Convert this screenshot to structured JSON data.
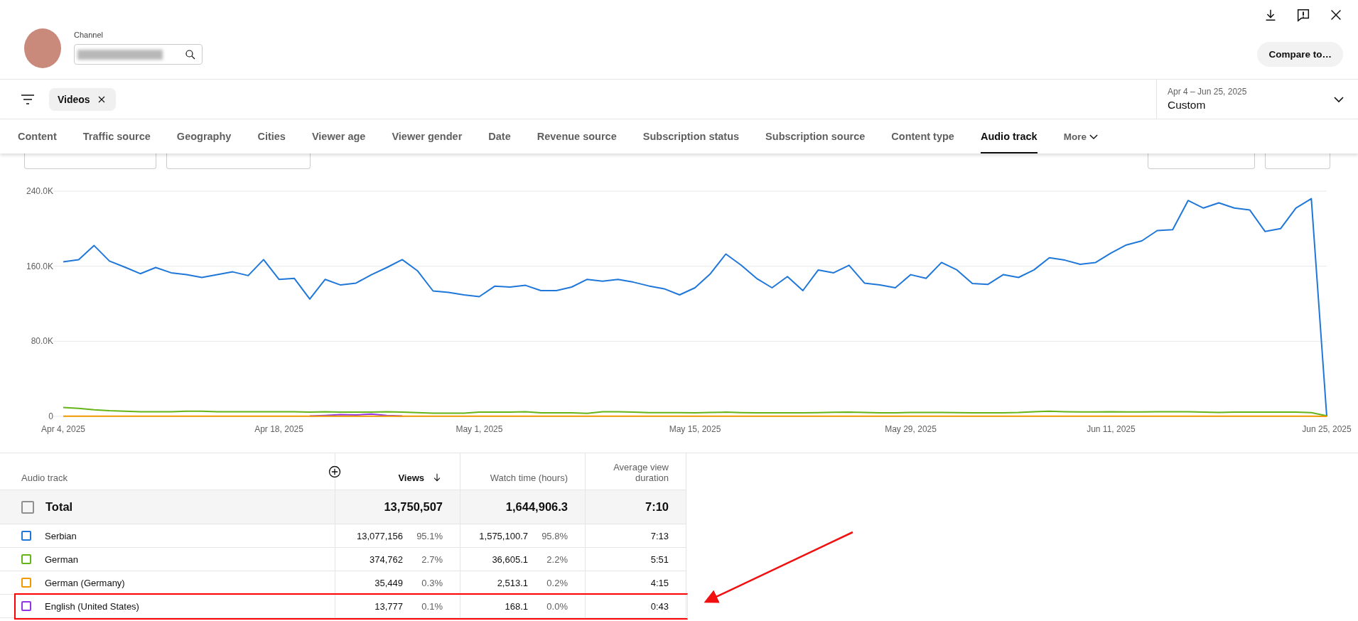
{
  "header": {
    "channel_label": "Channel",
    "compare_button": "Compare to…"
  },
  "filter_bar": {
    "chips": [
      {
        "label": "Videos"
      }
    ],
    "date_range": {
      "range": "Apr 4 – Jun 25, 2025",
      "preset": "Custom"
    }
  },
  "tabs": [
    {
      "label": "Content",
      "selected": false
    },
    {
      "label": "Traffic source",
      "selected": false
    },
    {
      "label": "Geography",
      "selected": false
    },
    {
      "label": "Cities",
      "selected": false
    },
    {
      "label": "Viewer age",
      "selected": false
    },
    {
      "label": "Viewer gender",
      "selected": false
    },
    {
      "label": "Date",
      "selected": false
    },
    {
      "label": "Revenue source",
      "selected": false
    },
    {
      "label": "Subscription status",
      "selected": false
    },
    {
      "label": "Subscription source",
      "selected": false
    },
    {
      "label": "Content type",
      "selected": false
    },
    {
      "label": "Audio track",
      "selected": true
    }
  ],
  "more_tab": {
    "label": "More"
  },
  "chart": {
    "chart_data": {
      "type": "line",
      "categories": [
        "Apr 4, 2025",
        null,
        null,
        null,
        null,
        null,
        null,
        null,
        null,
        null,
        null,
        null,
        null,
        null,
        "Apr 18, 2025",
        null,
        null,
        null,
        null,
        null,
        null,
        null,
        null,
        null,
        null,
        null,
        null,
        "May 1, 2025",
        null,
        null,
        null,
        null,
        null,
        null,
        null,
        null,
        null,
        null,
        null,
        null,
        null,
        "May 15, 2025",
        null,
        null,
        null,
        null,
        null,
        null,
        null,
        null,
        null,
        null,
        null,
        null,
        null,
        "May 29, 2025",
        null,
        null,
        null,
        null,
        null,
        null,
        null,
        null,
        null,
        null,
        null,
        null,
        "Jun 11, 2025",
        null,
        null,
        null,
        null,
        null,
        null,
        null,
        null,
        null,
        null,
        null,
        null,
        null,
        "Jun 25, 2025"
      ],
      "ylim": [
        0,
        240000
      ],
      "yticks": [
        {
          "value": 0,
          "label": "0"
        },
        {
          "value": 80000,
          "label": "80.0K"
        },
        {
          "value": 160000,
          "label": "160.0K"
        },
        {
          "value": 240000,
          "label": "240.0K"
        }
      ],
      "series": [
        {
          "color": "#1f77d9",
          "values": [
            164600,
            167000,
            182000,
            165500,
            159000,
            152000,
            158600,
            153000,
            151000,
            148000,
            151000,
            154000,
            150000,
            167000,
            146000,
            147000,
            125000,
            146000,
            140000,
            142000,
            151000,
            158600,
            167000,
            155000,
            133600,
            132000,
            129500,
            127600,
            138700,
            137800,
            139600,
            134000,
            134000,
            137800,
            146000,
            144000,
            146000,
            143000,
            139000,
            136000,
            129500,
            137000,
            152000,
            173000,
            161000,
            147000,
            137000,
            149000,
            134000,
            156000,
            153000,
            161000,
            142000,
            140000,
            137000,
            151000,
            147000,
            164000,
            156000,
            141500,
            140600,
            151000,
            148000,
            156000,
            169000,
            166500,
            162000,
            164000,
            174000,
            182700,
            187000,
            198000,
            199000,
            230000,
            222000,
            227500,
            222000,
            220000,
            197000,
            200000,
            222000,
            232000,
            0
          ]
        },
        {
          "color": "#65b418",
          "values": [
            9500,
            8500,
            7000,
            6000,
            5500,
            5000,
            5000,
            5000,
            5500,
            5500,
            5000,
            5000,
            5000,
            5000,
            5000,
            5000,
            4500,
            5000,
            4500,
            4500,
            4500,
            5000,
            4500,
            4000,
            3500,
            3500,
            3500,
            4500,
            4500,
            4500,
            5000,
            3800,
            3800,
            3800,
            3200,
            5000,
            5000,
            4500,
            4000,
            4000,
            4000,
            3800,
            4200,
            4500,
            4000,
            3800,
            3800,
            3800,
            3800,
            4000,
            4300,
            4500,
            4200,
            3800,
            3800,
            4200,
            4200,
            4200,
            4000,
            3800,
            3800,
            3800,
            4200,
            5000,
            5500,
            5000,
            4800,
            4800,
            5000,
            4800,
            4800,
            5000,
            5000,
            5000,
            4500,
            4200,
            4500,
            4500,
            4500,
            4500,
            4500,
            4000,
            500
          ]
        },
        {
          "color": "#9334e6",
          "values": [
            null,
            null,
            null,
            null,
            null,
            null,
            null,
            null,
            null,
            null,
            null,
            null,
            null,
            null,
            null,
            null,
            300,
            1000,
            2000,
            1500,
            2500,
            1000,
            300,
            null,
            null,
            null,
            null,
            null,
            null,
            null,
            null,
            null,
            null,
            null,
            null,
            null,
            null,
            null,
            null,
            null,
            null,
            null,
            null,
            null,
            null,
            null,
            null,
            null,
            null,
            null,
            null,
            null,
            null,
            null,
            null,
            null,
            null,
            null,
            null,
            null,
            null,
            null,
            null,
            null,
            null,
            null,
            null,
            null,
            null,
            null,
            null,
            null,
            null,
            null,
            null,
            null,
            null,
            null,
            null,
            null,
            null,
            null,
            null
          ]
        },
        {
          "color": "#f29900",
          "values": [
            200,
            200,
            200,
            200,
            200,
            200,
            200,
            200,
            200,
            200,
            200,
            200,
            200,
            200,
            200,
            200,
            200,
            200,
            200,
            200,
            200,
            200,
            200,
            200,
            200,
            200,
            200,
            200,
            200,
            200,
            200,
            200,
            200,
            200,
            200,
            200,
            200,
            200,
            200,
            200,
            200,
            200,
            200,
            200,
            200,
            200,
            200,
            200,
            200,
            200,
            200,
            200,
            200,
            200,
            200,
            200,
            200,
            200,
            200,
            200,
            200,
            200,
            200,
            200,
            200,
            200,
            200,
            200,
            200,
            200,
            200,
            200,
            200,
            200,
            200,
            200,
            200,
            200,
            200,
            200,
            200,
            200,
            0
          ]
        }
      ]
    }
  },
  "table": {
    "columns": [
      {
        "label": "Audio track",
        "sorted": false
      },
      {
        "label": "Views",
        "sorted": true
      },
      {
        "label": "Watch time (hours)",
        "sorted": false
      },
      {
        "label": "Average view duration",
        "sorted": false
      }
    ],
    "total": {
      "label": "Total",
      "checked": false,
      "views": "13,750,507",
      "watch_time": "1,644,906.3",
      "avg_duration": "7:10"
    },
    "rows": [
      {
        "name": "Serbian",
        "color": "#1f77d9",
        "views": "13,077,156",
        "views_pct": "95.1%",
        "watch_time": "1,575,100.7",
        "watch_pct": "95.8%",
        "avg_duration": "7:13",
        "highlighted": false
      },
      {
        "name": "German",
        "color": "#65b418",
        "views": "374,762",
        "views_pct": "2.7%",
        "watch_time": "36,605.1",
        "watch_pct": "2.2%",
        "avg_duration": "5:51",
        "highlighted": false
      },
      {
        "name": "German (Germany)",
        "color": "#f29900",
        "views": "35,449",
        "views_pct": "0.3%",
        "watch_time": "2,513.1",
        "watch_pct": "0.2%",
        "avg_duration": "4:15",
        "highlighted": false
      },
      {
        "name": "English (United States)",
        "color": "#9334e6",
        "views": "13,777",
        "views_pct": "0.1%",
        "watch_time": "168.1",
        "watch_pct": "0.0%",
        "avg_duration": "0:43",
        "highlighted": true
      }
    ]
  }
}
